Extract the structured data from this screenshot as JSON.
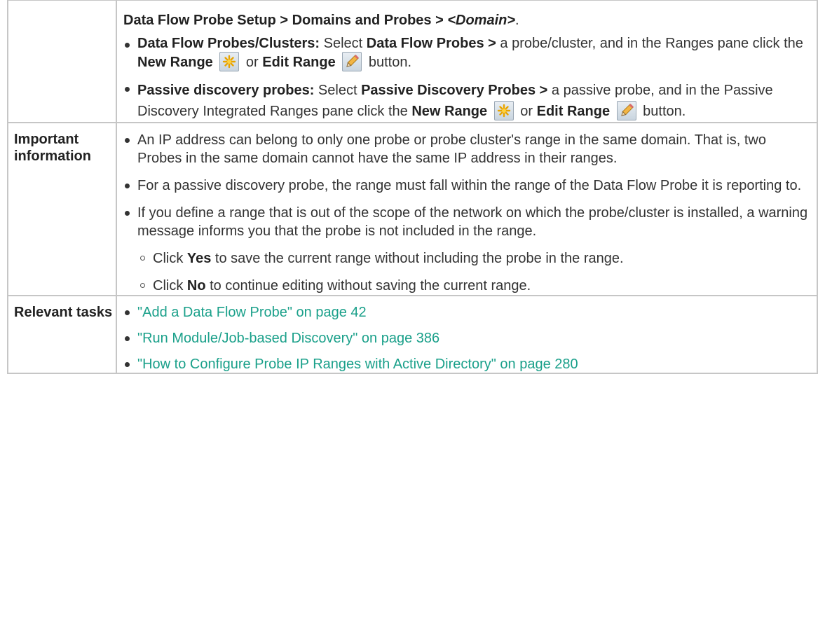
{
  "access": {
    "path_prefix": "Data Flow Probe Setup > Domains and Probes > ",
    "path_domain": "<Domain>",
    "path_end": ".",
    "items": [
      {
        "term": "Data Flow Probes/Clusters:",
        "t1": " Select ",
        "b1": "Data Flow Probes >",
        "t2": " a probe/cluster, and in the Ranges pane click the ",
        "b2": "New Range",
        "t3": " or ",
        "b3": "Edit Range",
        "t4": " button."
      },
      {
        "term": "Passive discovery probes:",
        "t1": " Select ",
        "b1": "Passive Discovery Probes >",
        "t2": " a passive probe, and in the Passive Discovery Integrated Ranges pane click the ",
        "b2": "New Range",
        "t3": " or ",
        "b3": "Edit Range",
        "t4": " button."
      }
    ]
  },
  "important": {
    "label": "Important information",
    "items": [
      "An IP address can belong to only one probe or probe cluster's range in the same domain. That is, two Probes in the same domain cannot have the same IP address in their ranges.",
      "For a passive discovery probe, the range must fall within the range of the Data Flow Probe it is reporting to.",
      "If you define a range that is out of the scope of the network on which the probe/cluster is installed, a warning message informs you that the probe is not included in the range."
    ],
    "subitems": [
      {
        "pre": "Click ",
        "bold": "Yes",
        "post": " to save the current range without including the probe in the range."
      },
      {
        "pre": "Click ",
        "bold": "No",
        "post": " to continue editing without saving the current range."
      }
    ]
  },
  "tasks": {
    "label": "Relevant tasks",
    "links": [
      "\"Add a Data Flow Probe\" on page 42",
      "\"Run Module/Job-based Discovery\" on page 386",
      "\"How to Configure Probe IP Ranges with Active Directory\" on page 280"
    ]
  },
  "colors": {
    "link": "#1aa08a",
    "border": "#c6c6c6",
    "text": "#333333"
  },
  "icons": {
    "new_range": "new-range-icon",
    "edit_range": "edit-range-icon"
  }
}
